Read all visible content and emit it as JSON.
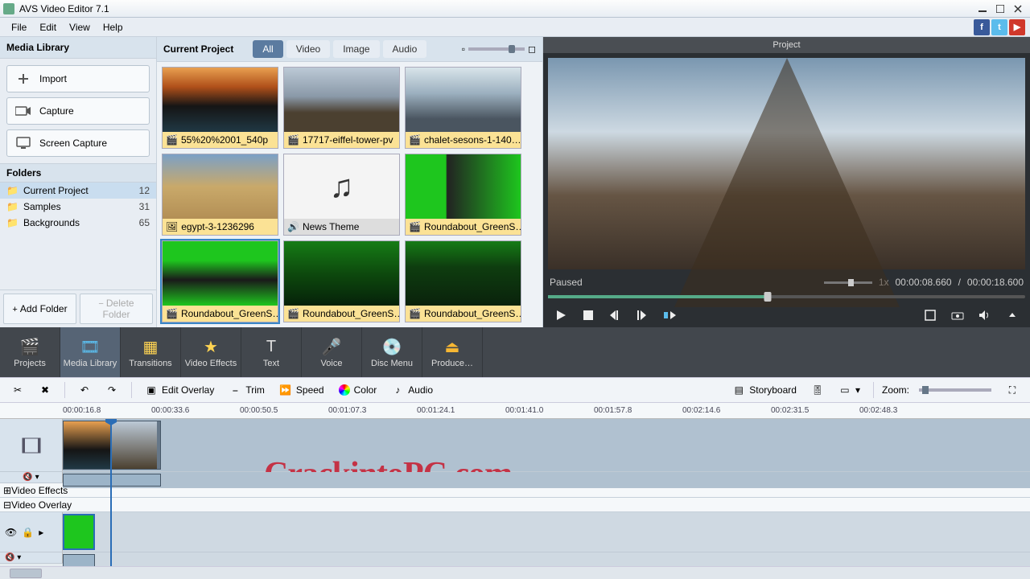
{
  "window": {
    "title": "AVS Video Editor 7.1"
  },
  "menu": [
    "File",
    "Edit",
    "View",
    "Help"
  ],
  "left": {
    "header": "Media Library",
    "buttons": [
      "Import",
      "Capture",
      "Screen Capture"
    ],
    "folders_header": "Folders",
    "folders": [
      {
        "name": "Current Project",
        "count": 12,
        "selected": true
      },
      {
        "name": "Samples",
        "count": 31,
        "selected": false
      },
      {
        "name": "Backgrounds",
        "count": 65,
        "selected": false
      }
    ],
    "add_folder": "Add Folder",
    "del_folder": "Delete Folder"
  },
  "gallery": {
    "title": "Current Project",
    "filters": [
      "All",
      "Video",
      "Image",
      "Audio"
    ],
    "active_filter": 0,
    "items": [
      {
        "name": "55%20%2001_540p",
        "type": "video",
        "bg": "linear-gradient(#e8a050 0%,#b0501a 30%,#151515 60%,#203844 100%)"
      },
      {
        "name": "17717-eiffel-tower-pv",
        "type": "video",
        "bg": "linear-gradient(#bcc9d6,#8a99a8 45%,#4b4030 70%)"
      },
      {
        "name": "chalet-sesons-1-140…",
        "type": "video",
        "bg": "linear-gradient(#d8e4ea,#9cb0bf 40%,#4a5560 80%)"
      },
      {
        "name": "egypt-3-1236296",
        "type": "image",
        "bg": "linear-gradient(#7ba0c6 0%,#c9a96a 50%,#b38f55 100%)"
      },
      {
        "name": "News Theme",
        "type": "audio",
        "bg": "#f4f4f4"
      },
      {
        "name": "Roundabout_GreenS…",
        "type": "video",
        "bg": "linear-gradient(90deg,#1ec61e 0%,#1ec61e 35%,#222 36%,#1ec61e 100%)"
      },
      {
        "name": "Roundabout_GreenS…",
        "type": "video",
        "bg": "linear-gradient(#1ec61e 0%,#1ec61e 30%,#1a1a1a 60%,#1ec61e 100%)"
      },
      {
        "name": "Roundabout_GreenS…",
        "type": "video",
        "bg": "linear-gradient(#167c16,#0d4a0d 50%,#06210a)"
      },
      {
        "name": "Roundabout_GreenS…",
        "type": "video",
        "bg": "linear-gradient(#167c16,#0e3d0f 40%,#0a220c)"
      }
    ],
    "selected": 6
  },
  "preview": {
    "title": "Project",
    "status": "Paused",
    "speed": "1x",
    "time_current": "00:00:08.660",
    "time_total": "00:00:18.600"
  },
  "modes": [
    "Projects",
    "Media Library",
    "Transitions",
    "Video Effects",
    "Text",
    "Voice",
    "Disc Menu",
    "Produce…"
  ],
  "modes_active": 1,
  "editbar": {
    "edit_overlay": "Edit Overlay",
    "trim": "Trim",
    "speed": "Speed",
    "color": "Color",
    "audio": "Audio",
    "storyboard": "Storyboard",
    "zoom": "Zoom:"
  },
  "timeline": {
    "ticks": [
      "00:00:16.8",
      "00:00:33.6",
      "00:00:50.5",
      "00:01:07.3",
      "00:01:24.1",
      "00:01:41.0",
      "00:01:57.8",
      "00:02:14.6",
      "00:02:31.5",
      "00:02:48.3"
    ],
    "track_fx": "Video Effects",
    "track_ov": "Video Overlay"
  },
  "watermark": "CrackintoPC.com"
}
